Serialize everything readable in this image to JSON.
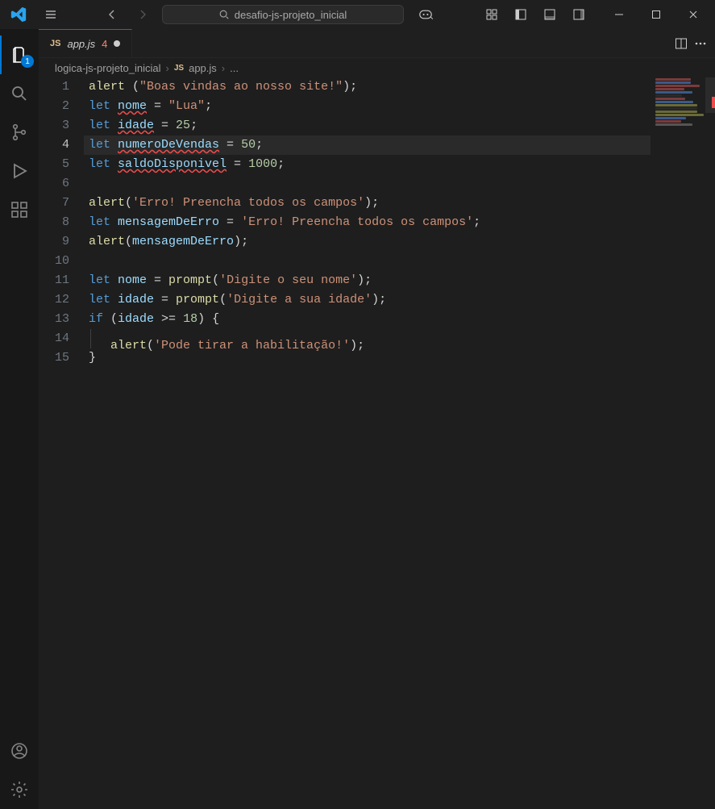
{
  "title_bar": {
    "search_text": "desafio-js-projeto_inicial"
  },
  "activity": {
    "explorer_badge": "1"
  },
  "tab": {
    "js_prefix": "JS",
    "filename": "app.js",
    "error_count": "4"
  },
  "breadcrumbs": {
    "folder": "logica-js-projeto_inicial",
    "js_prefix": "JS",
    "file": "app.js",
    "more": "..."
  },
  "code": {
    "lines": [
      {
        "num": "1",
        "tokens": [
          {
            "t": "fn",
            "v": "alert "
          },
          {
            "t": "p",
            "v": "("
          },
          {
            "t": "s",
            "v": "\"Boas vindas ao nosso site!\""
          },
          {
            "t": "p",
            "v": ");"
          }
        ]
      },
      {
        "num": "2",
        "tokens": [
          {
            "t": "k",
            "v": "let "
          },
          {
            "t": "v",
            "v": "nome",
            "err": true
          },
          {
            "t": "p",
            "v": " = "
          },
          {
            "t": "s",
            "v": "\"Lua\""
          },
          {
            "t": "p",
            "v": ";"
          }
        ]
      },
      {
        "num": "3",
        "tokens": [
          {
            "t": "k",
            "v": "let "
          },
          {
            "t": "v",
            "v": "idade",
            "err": true
          },
          {
            "t": "p",
            "v": " = "
          },
          {
            "t": "n",
            "v": "25"
          },
          {
            "t": "p",
            "v": ";"
          }
        ]
      },
      {
        "num": "4",
        "hl": true,
        "tokens": [
          {
            "t": "k",
            "v": "let "
          },
          {
            "t": "v",
            "v": "numeroDeVendas",
            "err": true
          },
          {
            "t": "p",
            "v": " = "
          },
          {
            "t": "n",
            "v": "50"
          },
          {
            "t": "p",
            "v": ";"
          }
        ]
      },
      {
        "num": "5",
        "tokens": [
          {
            "t": "k",
            "v": "let "
          },
          {
            "t": "v",
            "v": "saldoDisponivel",
            "err": true
          },
          {
            "t": "p",
            "v": " = "
          },
          {
            "t": "n",
            "v": "1000"
          },
          {
            "t": "p",
            "v": ";"
          }
        ]
      },
      {
        "num": "6",
        "tokens": []
      },
      {
        "num": "7",
        "tokens": [
          {
            "t": "fn",
            "v": "alert"
          },
          {
            "t": "p",
            "v": "("
          },
          {
            "t": "s",
            "v": "'Erro! Preencha todos os campos'"
          },
          {
            "t": "p",
            "v": ");"
          }
        ]
      },
      {
        "num": "8",
        "tokens": [
          {
            "t": "k",
            "v": "let "
          },
          {
            "t": "v",
            "v": "mensagemDeErro"
          },
          {
            "t": "p",
            "v": " = "
          },
          {
            "t": "s",
            "v": "'Erro! Preencha todos os campos'"
          },
          {
            "t": "p",
            "v": ";"
          }
        ]
      },
      {
        "num": "9",
        "tokens": [
          {
            "t": "fn",
            "v": "alert"
          },
          {
            "t": "p",
            "v": "("
          },
          {
            "t": "v",
            "v": "mensagemDeErro"
          },
          {
            "t": "p",
            "v": ");"
          }
        ]
      },
      {
        "num": "10",
        "tokens": []
      },
      {
        "num": "11",
        "tokens": [
          {
            "t": "k",
            "v": "let "
          },
          {
            "t": "v",
            "v": "nome"
          },
          {
            "t": "p",
            "v": " = "
          },
          {
            "t": "fn",
            "v": "prompt"
          },
          {
            "t": "p",
            "v": "("
          },
          {
            "t": "s",
            "v": "'Digite o seu nome'"
          },
          {
            "t": "p",
            "v": ");"
          }
        ]
      },
      {
        "num": "12",
        "tokens": [
          {
            "t": "k",
            "v": "let "
          },
          {
            "t": "v",
            "v": "idade"
          },
          {
            "t": "p",
            "v": " = "
          },
          {
            "t": "fn",
            "v": "prompt"
          },
          {
            "t": "p",
            "v": "("
          },
          {
            "t": "s",
            "v": "'Digite a sua idade'"
          },
          {
            "t": "p",
            "v": ");"
          }
        ]
      },
      {
        "num": "13",
        "tokens": [
          {
            "t": "k",
            "v": "if "
          },
          {
            "t": "p",
            "v": "("
          },
          {
            "t": "v",
            "v": "idade"
          },
          {
            "t": "p",
            "v": " >= "
          },
          {
            "t": "n",
            "v": "18"
          },
          {
            "t": "p",
            "v": ") {"
          }
        ]
      },
      {
        "num": "14",
        "indent": true,
        "tokens": [
          {
            "t": "fn",
            "v": "alert"
          },
          {
            "t": "p",
            "v": "("
          },
          {
            "t": "s",
            "v": "'Pode tirar a habilitação!'"
          },
          {
            "t": "p",
            "v": ");"
          }
        ]
      },
      {
        "num": "15",
        "tokens": [
          {
            "t": "p",
            "v": "}"
          }
        ]
      }
    ]
  },
  "minimap_colors": [
    "#7a3b3b",
    "#3a5a8a",
    "#7a3b3b",
    "#7a3b3b",
    "#3a5a8a",
    "#2a2a2a",
    "#7a3b3b",
    "#3a5a8a",
    "#6a6a3a",
    "#2a2a2a",
    "#6a6a3a",
    "#6a6a3a",
    "#3a5a8a",
    "#7a3b3b",
    "#555"
  ]
}
